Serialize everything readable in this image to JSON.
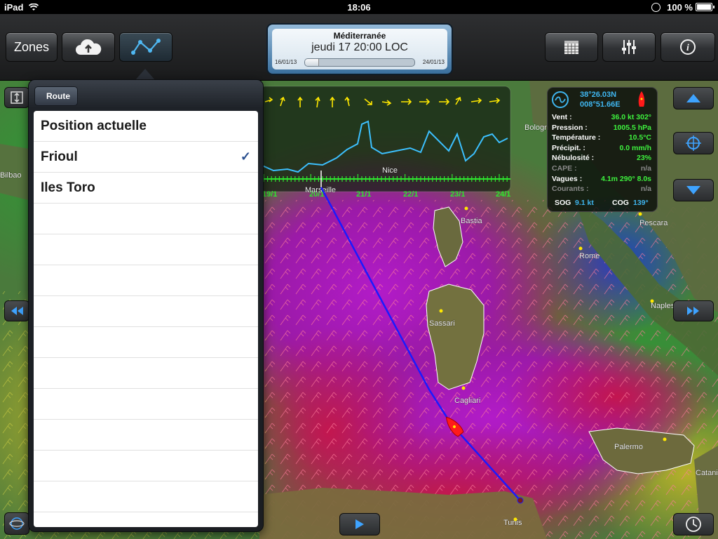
{
  "status_bar": {
    "device": "iPad",
    "time": "18:06",
    "battery": "100 %"
  },
  "toolbar": {
    "zones_label": "Zones",
    "zone": {
      "name": "Méditerranée",
      "datetime": "jeudi 17 20:00 LOC",
      "start_date": "16/01/13",
      "end_date": "24/01/13",
      "progress": 0.12
    }
  },
  "popover": {
    "back_label": "Route",
    "items": [
      {
        "label": "Position actuelle",
        "checked": false
      },
      {
        "label": "Frioul",
        "checked": true
      },
      {
        "label": "Iles Toro",
        "checked": false
      }
    ],
    "empty_rows": 10,
    "check_glyph": "✓"
  },
  "info_panel": {
    "lat": "38°26.03N",
    "lon": "008°51.66E",
    "rows": [
      {
        "key": "Vent :",
        "value": "36.0 kt 302°",
        "dim": false
      },
      {
        "key": "Pression :",
        "value": "1005.5 hPa",
        "dim": false
      },
      {
        "key": "Température :",
        "value": "10.5°C",
        "dim": false
      },
      {
        "key": "Précipit. :",
        "value": "0.0 mm/h",
        "dim": false
      },
      {
        "key": "Nébulosité :",
        "value": "23%",
        "dim": false
      },
      {
        "key": "CAPE :",
        "value": "n/a",
        "dim": true
      },
      {
        "key": "Vagues :",
        "value": "4.1m 290° 8.0s",
        "dim": false
      },
      {
        "key": "Courants :",
        "value": "n/a",
        "dim": true
      }
    ],
    "sog_label": "SOG",
    "sog_value": "9.1 kt",
    "cog_label": "COG",
    "cog_value": "139°"
  },
  "map": {
    "cities": [
      {
        "name": "Bilbao"
      },
      {
        "name": "Nice"
      },
      {
        "name": "Marseille"
      },
      {
        "name": "Bologn"
      },
      {
        "name": "Bastia"
      },
      {
        "name": "Pescara"
      },
      {
        "name": "Rome"
      },
      {
        "name": "Naples"
      },
      {
        "name": "Sassari"
      },
      {
        "name": "Cagliari"
      },
      {
        "name": "Palermo"
      },
      {
        "name": "Catania"
      },
      {
        "name": "Tunis"
      }
    ],
    "timeline_dates": [
      "19/1",
      "20/1",
      "21/1",
      "22/1",
      "23/1",
      "24/1"
    ]
  },
  "colors": {
    "route_line": "#1a1aff",
    "boat": "#ff1a1a",
    "timeline_curve": "#3cc0ff",
    "tick_green": "#2ee82e",
    "info_value": "#3ef23e",
    "info_coord": "#3fb6f0"
  },
  "icons": {
    "cloud": "cloud-upload-icon",
    "route": "route-icon",
    "calendar": "calendar-icon",
    "settings": "sliders-icon",
    "info": "info-icon"
  }
}
